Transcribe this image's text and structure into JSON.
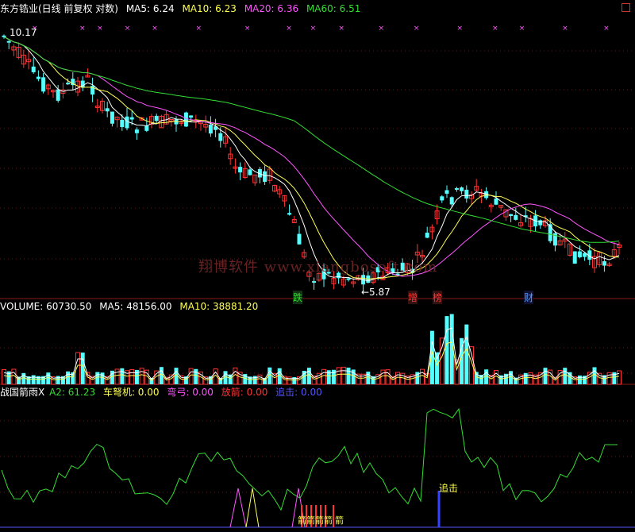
{
  "header": {
    "title": "东方锆业(日线 前复权 对数)",
    "ma5": "MA5: 6.24",
    "ma10": "MA10: 6.23",
    "ma20": "MA20: 6.36",
    "ma60": "MA60: 6.51",
    "colors": {
      "ma5": "#ffffff",
      "ma10": "#ffff55",
      "ma20": "#ff55ff",
      "ma60": "#33dd33"
    }
  },
  "volume_header": {
    "label": "VOLUME: 60730.50",
    "ma5": "MA5: 48156.00",
    "ma10": "MA10: 38881.20"
  },
  "indicator_header": {
    "name": "战国箭雨X",
    "a2": "A2: 61.23",
    "chenu": "车弩机: 0.00",
    "gong": "弯弓: 0.00",
    "fangjian": "放箭: 0.00",
    "zhuiji": "追击: 0.00",
    "colors": {
      "a2": "#33dd33",
      "chenu": "#ffff55",
      "gong": "#ff55ff",
      "fangjian": "#ff3333",
      "zhuiji": "#5555ff"
    }
  },
  "price_labels": {
    "high": "10.17",
    "low": "←5.87"
  },
  "event_labels": {
    "die": "跌",
    "zeng": "增",
    "bang": "榜",
    "cai": "财"
  },
  "indicator_labels": {
    "zhuiji": "追击",
    "jian": "箭箭箭箭",
    "jian2": "箭"
  },
  "watermark": "翔博软件  www.xiangbosoft.com",
  "chart_data": [
    {
      "type": "candlestick",
      "panel": "price",
      "scale": "log",
      "price_range": [
        5.5,
        10.5
      ],
      "series": [
        {
          "name": "MA5",
          "values": [
            6.24
          ]
        },
        {
          "name": "MA10",
          "values": [
            6.23
          ]
        },
        {
          "name": "MA20",
          "values": [
            6.36
          ]
        },
        {
          "name": "MA60",
          "values": [
            6.51
          ]
        }
      ],
      "annotations": [
        "10.17",
        "←5.87"
      ]
    },
    {
      "type": "bar",
      "panel": "volume",
      "series": [
        {
          "name": "VOLUME",
          "values": [
            60730.5
          ]
        },
        {
          "name": "MA5",
          "values": [
            48156.0
          ]
        },
        {
          "name": "MA10",
          "values": [
            38881.2
          ]
        }
      ]
    },
    {
      "type": "line",
      "panel": "indicator",
      "title": "战国箭雨X",
      "series": [
        {
          "name": "A2",
          "values": [
            61.23
          ]
        },
        {
          "name": "车弩机",
          "values": [
            0.0
          ]
        },
        {
          "name": "弯弓",
          "values": [
            0.0
          ]
        },
        {
          "name": "放箭",
          "values": [
            0.0
          ]
        },
        {
          "name": "追击",
          "values": [
            0.0
          ]
        }
      ]
    }
  ]
}
